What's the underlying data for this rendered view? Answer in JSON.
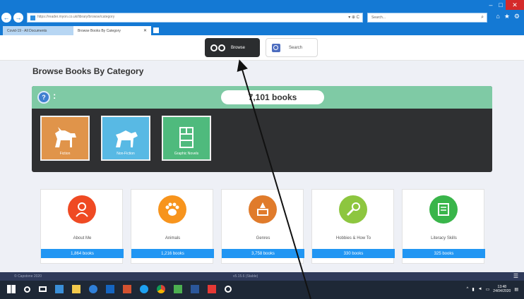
{
  "browser": {
    "window_controls": {
      "minimize": "–",
      "maximize": "□",
      "close": "✕",
      "close_label": "Clo"
    },
    "address_text": "https://reader.myon.co.uk/library/browse/category",
    "address_tools": "▾ ⊕ C",
    "search_placeholder": "Search...",
    "tabs": [
      {
        "label": "Covid-19 - All Documents",
        "active": false
      },
      {
        "label": "Browse Books By Category",
        "active": true
      }
    ]
  },
  "topbar": {
    "browse_label": "Browse",
    "search_label": "Search"
  },
  "page": {
    "heading": "Browse Books By Category",
    "help_icon": "?",
    "book_count": "7,101 books",
    "top_categories": [
      {
        "label": "Fiction",
        "color": "#e0944a",
        "icon": "unicorn-icon"
      },
      {
        "label": "Non-Fiction",
        "color": "#58b9e4",
        "icon": "horse-icon"
      },
      {
        "label": "Graphic Novels",
        "color": "#4fba7d",
        "icon": "comic-icon"
      }
    ],
    "categories": [
      {
        "name": "About Me",
        "books": "1,864 books",
        "color": "#ef4a23",
        "icon": "person-icon"
      },
      {
        "name": "Animals",
        "books": "1,216 books",
        "color": "#f7941d",
        "icon": "paw-icon"
      },
      {
        "name": "Genres",
        "books": "3,758 books",
        "color": "#e07b2b",
        "icon": "genres-icon"
      },
      {
        "name": "Hobbies & How To",
        "books": "330 books",
        "color": "#8dc63f",
        "icon": "hobbies-icon"
      },
      {
        "name": "Literacy Skills",
        "books": "325 books",
        "color": "#39b54a",
        "icon": "literacy-icon"
      }
    ]
  },
  "footer": {
    "left": "© Capstone 2020",
    "mid": "v5.15.6 (Stable)",
    "menu_icon": "☰"
  },
  "taskbar": {
    "time": "13:48",
    "date": "24/04/2020"
  }
}
